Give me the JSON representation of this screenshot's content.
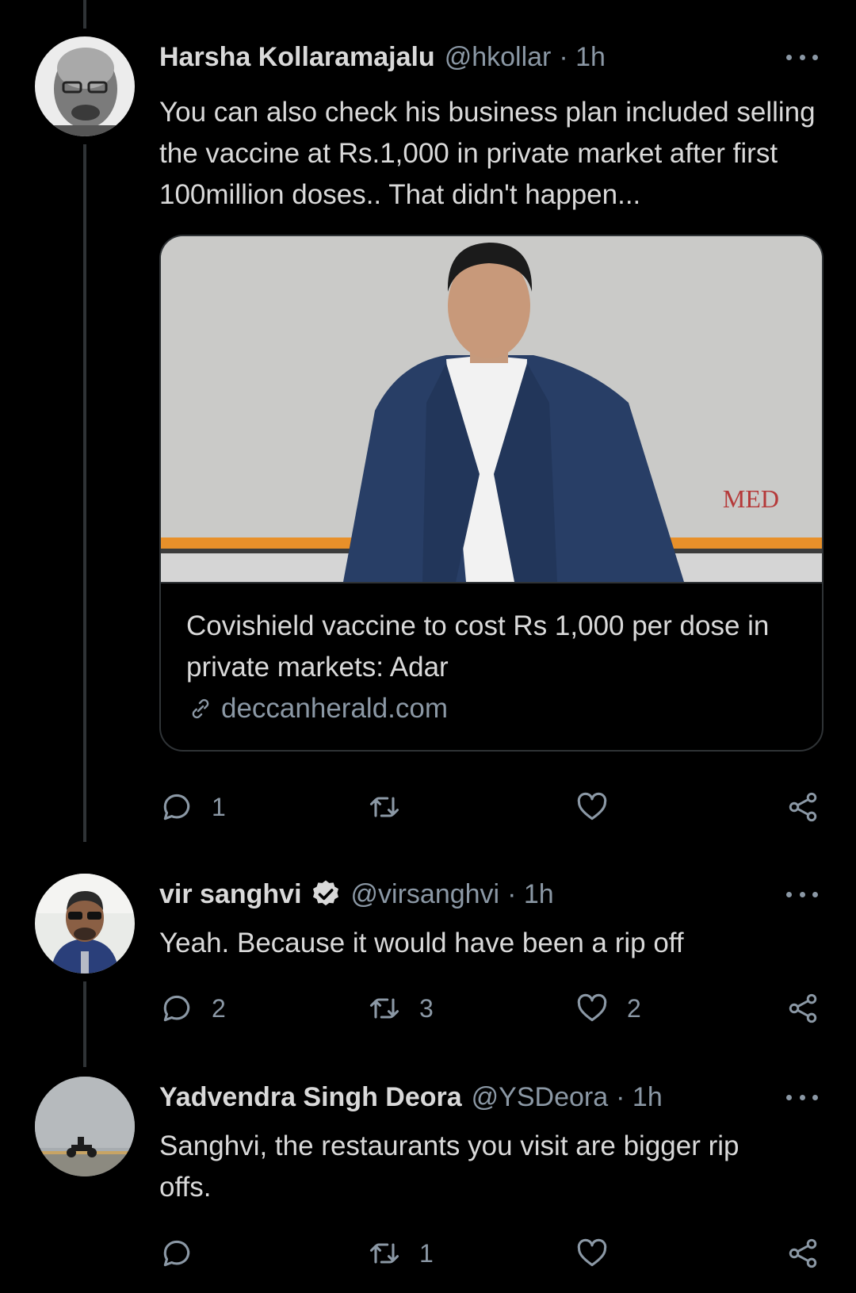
{
  "tweets": [
    {
      "name": "Harsha Kollaramajalu",
      "handle": "@hkollar",
      "time": "· 1h",
      "verified": false,
      "text": "You can also check his business plan included selling the vaccine at Rs.1,000 in private market after first 100million doses.. That didn't happen...",
      "card": {
        "title": "Covishield vaccine to cost Rs 1,000 per dose in private markets: Adar",
        "domain": "deccanherald.com",
        "image_caption": "MED"
      },
      "actions": {
        "reply_count": "1",
        "retweet_count": "",
        "like_count": ""
      }
    },
    {
      "name": "vir sanghvi",
      "handle": "@virsanghvi",
      "time": "· 1h",
      "verified": true,
      "text": "Yeah. Because it would have been a rip off",
      "actions": {
        "reply_count": "2",
        "retweet_count": "3",
        "like_count": "2"
      }
    },
    {
      "name": "Yadvendra Singh Deora",
      "handle": "@YSDeora",
      "time": "· 1h",
      "verified": false,
      "text": "Sanghvi, the restaurants you visit are bigger rip offs.",
      "actions": {
        "reply_count": "",
        "retweet_count": "1",
        "like_count": ""
      }
    }
  ],
  "icons": {
    "reply": "reply-icon",
    "retweet": "retweet-icon",
    "like": "heart-icon",
    "share": "share-icon",
    "more": "more-icon",
    "verified": "verified-badge-icon",
    "link": "link-icon"
  },
  "colors": {
    "background": "#000000",
    "text": "#d9d9d9",
    "secondary": "#8b98a5",
    "border": "#2f3336"
  }
}
